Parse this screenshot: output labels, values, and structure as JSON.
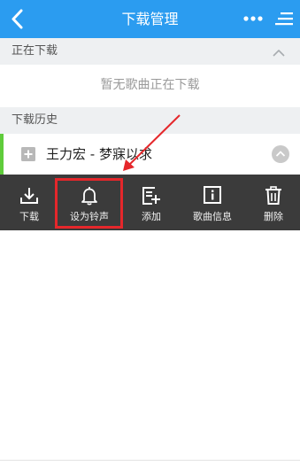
{
  "header": {
    "title": "下载管理",
    "back_icon": "chevron-left-icon",
    "more_icon": "more-dots-icon",
    "menu_icon": "menu-icon",
    "bg_color": "#2b9cf0"
  },
  "downloading": {
    "label": "正在下载",
    "empty_text": "暂无歌曲正在下载",
    "toggle_icon": "chevron-up-icon"
  },
  "history": {
    "label": "下载历史",
    "items": [
      {
        "title": "王力宏 - 梦寐以求"
      }
    ]
  },
  "toolbar": {
    "items": [
      {
        "label": "下载",
        "icon": "download-icon"
      },
      {
        "label": "设为铃声",
        "icon": "bell-icon"
      },
      {
        "label": "添加",
        "icon": "add-to-list-icon"
      },
      {
        "label": "歌曲信息",
        "icon": "info-icon"
      },
      {
        "label": "删除",
        "icon": "trash-icon"
      }
    ],
    "bg_color": "#3b3b3b"
  },
  "annotation": {
    "color": "#e5272b",
    "highlight_target": "设为铃声"
  },
  "colors": {
    "accent_green": "#5fcc3b",
    "section_bg": "#eef0f2"
  }
}
